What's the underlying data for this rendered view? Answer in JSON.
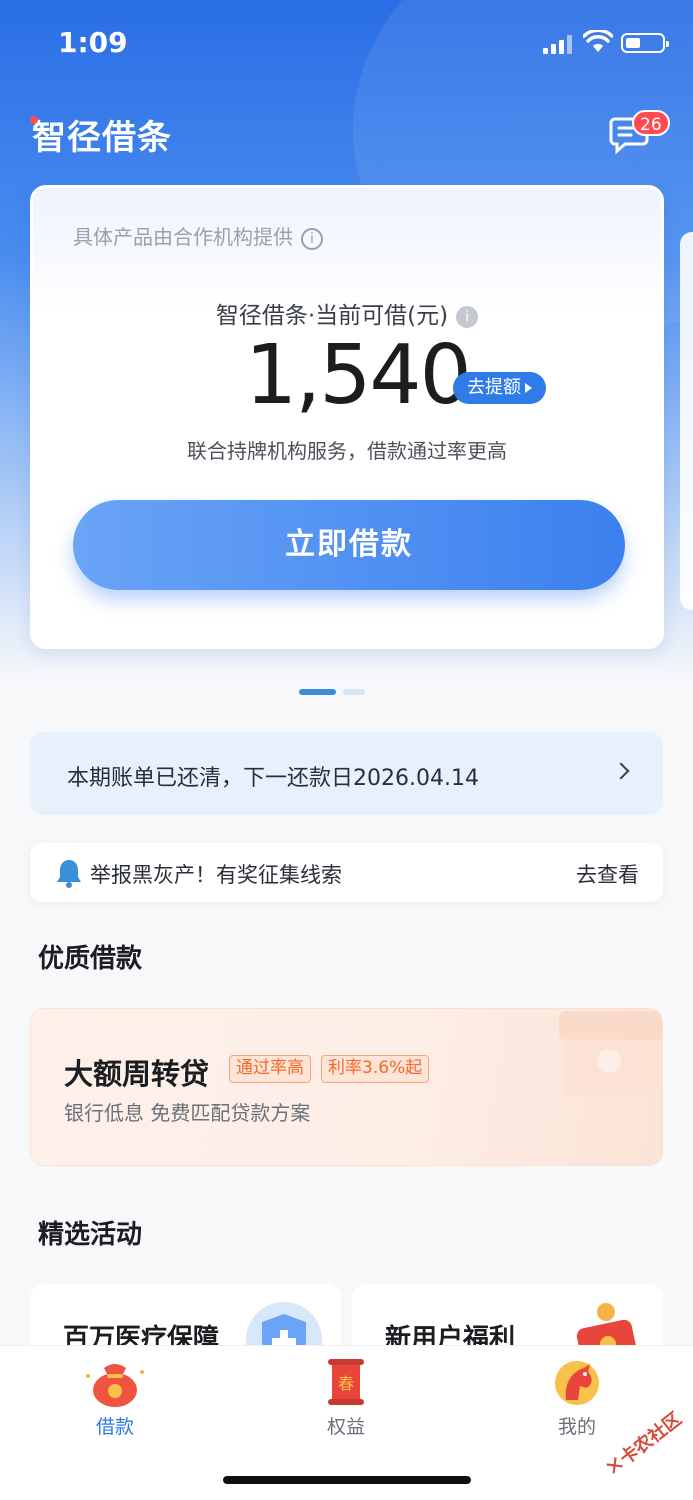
{
  "status_bar": {
    "time": "1:09"
  },
  "header": {
    "title": "智径借条",
    "message_badge": "26"
  },
  "credit_card": {
    "provider_note": "具体产品由合作机构提供",
    "limit_label": "智径借条·当前可借(元)",
    "amount": "1,540",
    "raise_limit_label": "去提额",
    "service_note": "联合持牌机构服务，借款通过率更高",
    "borrow_button_label": "立即借款"
  },
  "carousel": {
    "pages": 2,
    "active_index": 0
  },
  "bill_notice": {
    "text": "本期账单已还清，下一还款日2026.04.14"
  },
  "report_notice": {
    "text": "举报黑灰产！有奖征集线索",
    "link_label": "去查看"
  },
  "quality_loans": {
    "section_title": "优质借款",
    "card": {
      "name": "大额周转贷",
      "tags": [
        "通过率高",
        "利率3.6%起"
      ],
      "description": "银行低息 免费匹配贷款方案"
    }
  },
  "activities": {
    "section_title": "精选活动",
    "items": [
      {
        "title": "百万医疗保障",
        "icon": "shield-icon"
      },
      {
        "title": "新用户福利",
        "icon": "red-envelope-icon"
      }
    ]
  },
  "tabbar": {
    "items": [
      {
        "label": "借款",
        "icon": "money-bag-icon",
        "active": true
      },
      {
        "label": "权益",
        "icon": "scroll-icon",
        "active": false
      },
      {
        "label": "我的",
        "icon": "horse-icon",
        "active": false
      }
    ]
  },
  "watermark": {
    "text": "卡农社区"
  },
  "colors": {
    "primary": "#2f7be8",
    "badge": "#ff4d4f",
    "tag_orange": "#f06a2c"
  }
}
